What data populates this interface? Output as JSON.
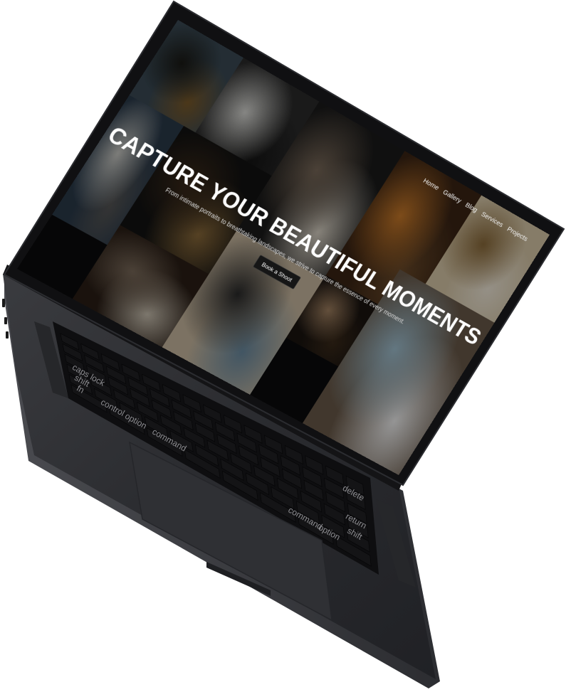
{
  "site": {
    "nav": [
      {
        "label": "Home"
      },
      {
        "label": "Gallery"
      },
      {
        "label": "Blog"
      },
      {
        "label": "Services"
      },
      {
        "label": "Projects"
      }
    ],
    "hero": {
      "title": "CAPTURE YOUR BEAUTIFUL MOMENTS",
      "subtitle": "From intimate portraits to breathtaking landscapes, we strive to capture the essence of every moment.",
      "cta": "Book a Shoot"
    }
  },
  "keyboard": {
    "labels": {
      "caps": "caps lock",
      "shift_left": "shift",
      "fn": "fn",
      "control": "control",
      "option_left": "option",
      "command_left": "command",
      "command_right": "command",
      "option_right": "option",
      "delete": "delete",
      "return": "return",
      "shift_right": "shift"
    }
  },
  "gallery": {
    "tiles": [
      {
        "name": "mountain-dusk",
        "colors": [
          "#3a4a55",
          "#1a1a16",
          "#7a5a2a"
        ]
      },
      {
        "name": "white-house",
        "colors": [
          "#2a2a2a",
          "#d8d8d4",
          "#151515"
        ]
      },
      {
        "name": "modern-tower",
        "colors": [
          "#2a3a4a",
          "#c9c9c4",
          "#555"
        ]
      },
      {
        "name": "still-life-vase",
        "colors": [
          "#121212",
          "#3b2a1a",
          "#8a6a3a"
        ]
      },
      {
        "name": "bark-texture",
        "colors": [
          "#2a1e16",
          "#7a6a5a",
          "#c9c0b0"
        ]
      },
      {
        "name": "cave-beach",
        "colors": [
          "#1a1a1a",
          "#7a6a5a",
          "#d9d2c5"
        ]
      },
      {
        "name": "autumn-tree",
        "colors": [
          "#3a2414",
          "#c97a2a",
          "#6a4a2a"
        ]
      },
      {
        "name": "traveler-hat",
        "colors": [
          "#1a1410",
          "#a08060",
          "#3a2a1a"
        ]
      },
      {
        "name": "portholes-door",
        "colors": [
          "#c9b9a0",
          "#2a2a2a",
          "#6a8aa0"
        ]
      },
      {
        "name": "ornate-interior",
        "colors": [
          "#d8c8a8",
          "#8a6a3a",
          "#f0e8d8"
        ]
      },
      {
        "name": "cliff-sea",
        "colors": [
          "#6a5a4a",
          "#a0c0d0",
          "#f0f0f0"
        ]
      }
    ]
  },
  "colors": {
    "body_top": "#2a2b2e",
    "body_bottom": "#1c1d20",
    "keyboard_well": "#0e0e10",
    "key": "#141416",
    "bezel": "#0a0a0a"
  }
}
